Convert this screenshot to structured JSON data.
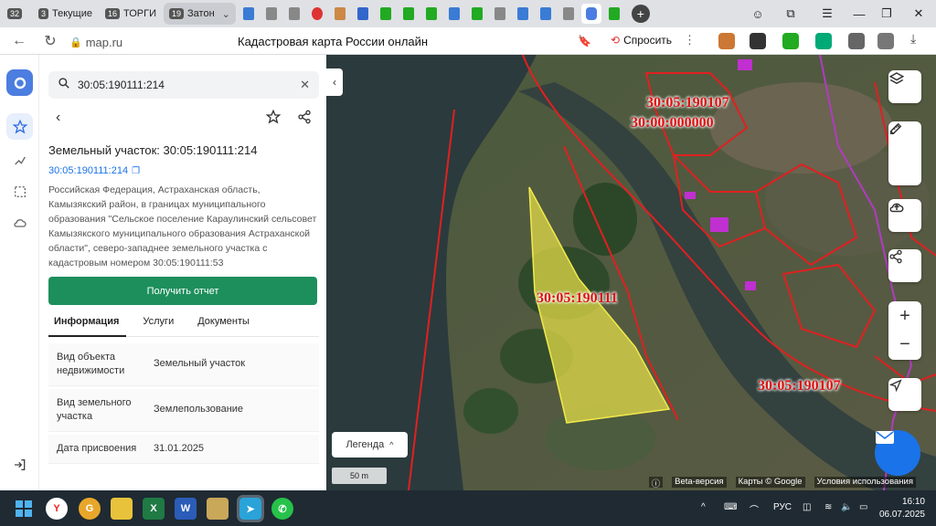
{
  "tabs": [
    {
      "count": "32",
      "label": ""
    },
    {
      "count": "3",
      "label": "Текущие"
    },
    {
      "count": "16",
      "label": "ТОРГИ"
    },
    {
      "count": "19",
      "label": "Затон",
      "active": true
    }
  ],
  "address_bar": {
    "domain": "map.ru",
    "page_title": "Кадастровая карта России онлайн",
    "ask_label": "Спросить"
  },
  "search": {
    "value": "30:05:190111:214"
  },
  "object": {
    "heading": "Земельный участок: 30:05:190111:214",
    "cad_number": "30:05:190111:214",
    "address": "Российская Федерация, Астраханская область, Камызякский район, в границах муниципального образования \"Сельское поселение Караулинский сельсовет Камызякского муниципального образования Астраханской области\", северо-западнее земельного участка с кадастровым номером 30:05:190111:53",
    "report_button": "Получить отчет"
  },
  "info_tabs": [
    "Информация",
    "Услуги",
    "Документы"
  ],
  "properties": [
    {
      "label": "Вид объекта недвижимости",
      "value": "Земельный участок"
    },
    {
      "label": "Вид земельного участка",
      "value": "Землепользование"
    },
    {
      "label": "Дата присвоения",
      "value": "31.01.2025"
    }
  ],
  "map": {
    "labels": [
      "30:05:190107",
      "30:00:000000",
      "30:05:190111",
      "30:05:190107"
    ],
    "legend_label": "Легенда",
    "scale_label": "50 m",
    "beta_label": "Beta-версия",
    "attribution_maps": "Карты © Google",
    "attribution_terms": "Условия использования",
    "parcel_color": "#e8e04a",
    "boundary_color": "#e02020",
    "district_color": "#b03cc0"
  },
  "taskbar": {
    "lang": "РУС",
    "time": "16:10",
    "date": "06.07.2025"
  }
}
